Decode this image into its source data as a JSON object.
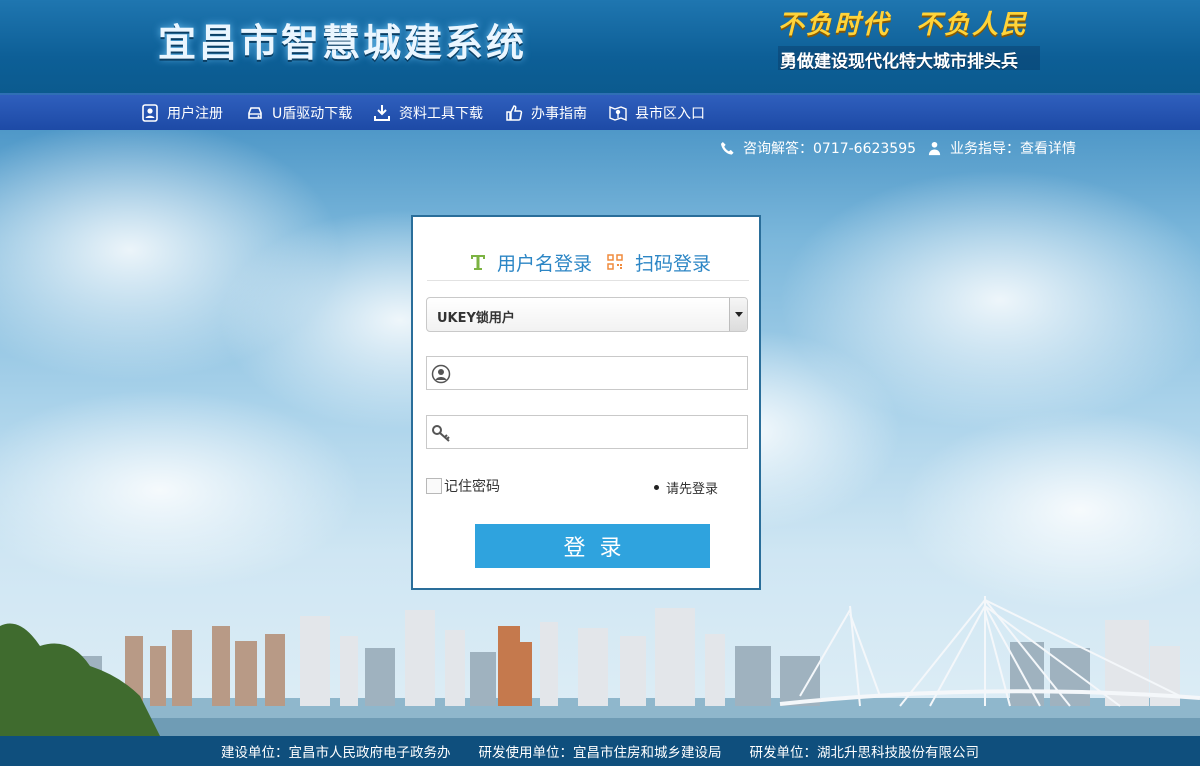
{
  "header": {
    "system_title": "宜昌市智慧城建系统",
    "slogan_top": [
      "不负时代",
      "不负人民"
    ],
    "slogan_bottom": "勇做建设现代化特大城市排头兵"
  },
  "nav": {
    "items": [
      {
        "label": "用户注册",
        "icon": "user-register-icon"
      },
      {
        "label": "U盾驱动下载",
        "icon": "usb-drive-icon"
      },
      {
        "label": "资料工具下载",
        "icon": "download-icon"
      },
      {
        "label": "办事指南",
        "icon": "thumbs-up-icon"
      },
      {
        "label": "县市区入口",
        "icon": "map-entry-icon"
      }
    ]
  },
  "contact": {
    "phone": "咨询解答：0717-6623595",
    "guidance": "业务指导：查看详情"
  },
  "login": {
    "tabs": [
      {
        "label": "用户名登录",
        "icon": "text-t-icon"
      },
      {
        "label": "扫码登录",
        "icon": "qr-code-icon"
      }
    ],
    "user_type_selected": "UKEY锁用户",
    "username_value": "",
    "password_value": "",
    "remember_label": "记住密码",
    "remember_checked": false,
    "status_text": "请先登录",
    "submit_label": "登录"
  },
  "footer": {
    "builder": "建设单位：宜昌市人民政府电子政务办",
    "user_unit": "研发使用单位：宜昌市住房和城乡建设局",
    "developer": "研发单位：湖北升思科技股份有限公司"
  },
  "colors": {
    "header_blue": "#0d5f97",
    "nav_blue": "#1d4aa6",
    "tab_text_blue": "#2c86c5",
    "button_blue": "#2fa3de",
    "footer_blue": "#0f4f7d",
    "slogan_gold": "#ffd43a"
  }
}
